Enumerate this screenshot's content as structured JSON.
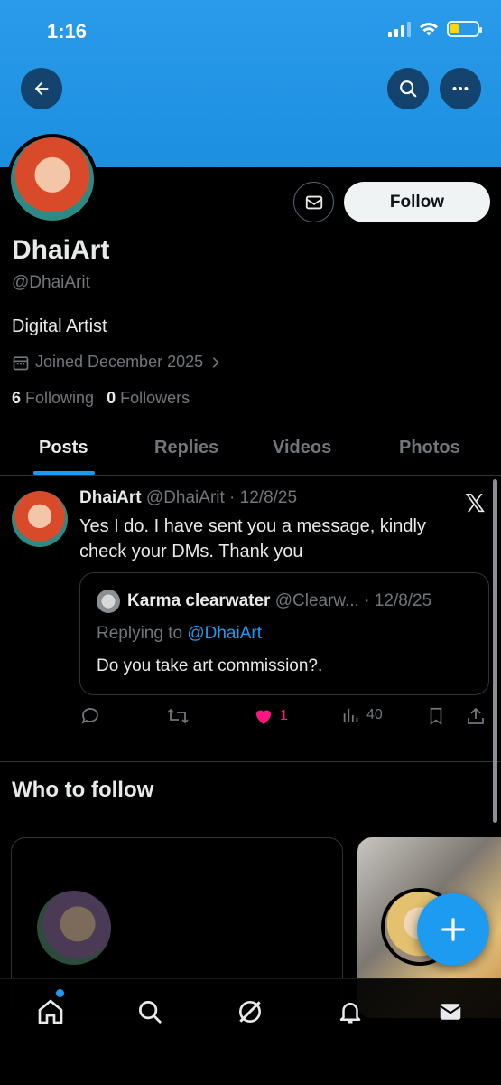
{
  "status_bar": {
    "time": "1:16"
  },
  "profile": {
    "display_name": "DhaiArt",
    "handle": "@DhaiArit",
    "bio": "Digital Artist",
    "joined": "Joined December 2025",
    "following_count": "6",
    "following_label": "Following",
    "followers_count": "0",
    "followers_label": "Followers",
    "follow_button": "Follow"
  },
  "tabs": [
    "Posts",
    "Replies",
    "Videos",
    "Photos"
  ],
  "post": {
    "author_name": "DhaiArt",
    "author_meta": "@DhaiArit · 12/8/25",
    "text": "Yes I do. I have sent you a message, kindly check your DMs. Thank you",
    "quote": {
      "author_name": "Karma clearwater",
      "author_meta": "@Clearw... · 12/8/25",
      "replying_prefix": "Replying to",
      "replying_to": "@DhaiArt",
      "text": "Do you take art commission?."
    },
    "likes": "1",
    "views": "40"
  },
  "who_to_follow": {
    "title": "Who to follow"
  },
  "colors": {
    "accent": "#1d9bf0",
    "like": "#f91880",
    "banner": "#1d8fe0"
  }
}
